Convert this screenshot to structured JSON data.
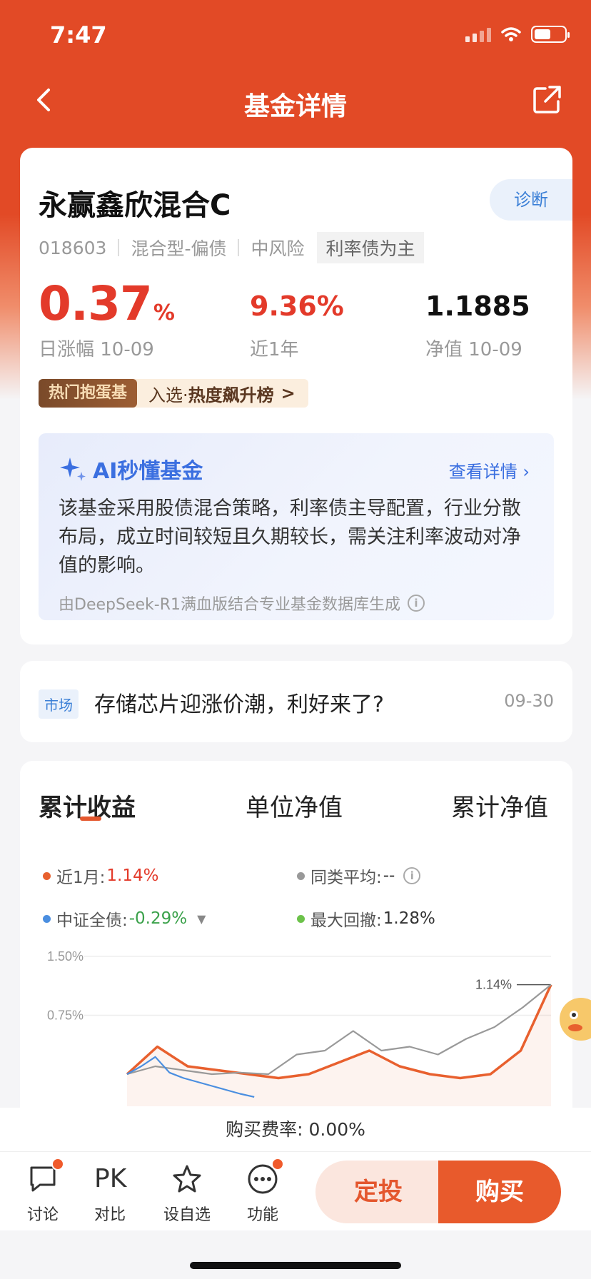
{
  "status_bar": {
    "time": "7:47"
  },
  "nav": {
    "title": "基金详情"
  },
  "fund": {
    "name": "永赢鑫欣混合C",
    "diagnose_label": "诊断",
    "code": "018603",
    "type": "混合型-偏债",
    "risk": "中风险",
    "tag": "利率债为主",
    "daily_change_value": "0.37",
    "daily_change_unit": "%",
    "daily_change_label": "日涨幅 10-09",
    "one_year_value": "9.36%",
    "one_year_label": "近1年",
    "nav_value": "1.1885",
    "nav_label": "净值 10-09",
    "hot_badge": "热门抱蛋基",
    "hot_text_prefix": "入选·",
    "hot_text_bold": "热度飙升榜"
  },
  "ai": {
    "title": "AI秒懂基金",
    "more_label": "查看详情",
    "summary": "该基金采用股债混合策略，利率债主导配置，行业分散布局，成立时间较短且久期较长，需关注利率波动对净值的影响。",
    "footer": "由DeepSeek-R1满血版结合专业基金数据库生成"
  },
  "news": {
    "tag": "市场",
    "title": "存储芯片迎涨价潮，利好来了?",
    "date": "09-30"
  },
  "chart_tabs": [
    "累计收益",
    "单位净值",
    "累计净值"
  ],
  "legend": {
    "fund_label": "近1月:",
    "fund_value": "1.14%",
    "peer_label": "同类平均:",
    "peer_value": "--",
    "index_label": "中证全债:",
    "index_value": "-0.29%",
    "drawdown_label": "最大回撤:",
    "drawdown_value": "1.28%"
  },
  "colors": {
    "fund": "#e8602e",
    "peer": "#999999",
    "index": "#4a8ee0",
    "drawdown": "#6cc24a",
    "accent": "#e24a26"
  },
  "chart_data": {
    "type": "line",
    "y_ticks": [
      "1.50%",
      "0.75%"
    ],
    "ylim": [
      0,
      1.5
    ],
    "end_label": "1.14%",
    "series": [
      {
        "name": "近1月",
        "values": [
          0.0,
          0.35,
          0.1,
          0.05,
          0.0,
          -0.05,
          0.0,
          0.15,
          0.3,
          0.1,
          0.0,
          -0.05,
          0.0,
          0.3,
          1.14
        ]
      },
      {
        "name": "同类平均",
        "values": [
          0.0,
          0.1,
          0.05,
          0.0,
          0.02,
          0.0,
          0.25,
          0.3,
          0.55,
          0.3,
          0.35,
          0.25,
          0.45,
          0.6,
          0.85,
          1.14
        ]
      },
      {
        "name": "中证全债",
        "values": [
          0.0,
          0.1,
          0.22,
          0.02,
          -0.05,
          -0.1,
          -0.15,
          -0.2,
          -0.25,
          -0.29
        ]
      }
    ]
  },
  "fee": {
    "text": "购买费率: 0.00%"
  },
  "bottom": {
    "discuss": "讨论",
    "pk_icon": "PK",
    "pk": "对比",
    "watch": "设自选",
    "func": "功能",
    "dingtou": "定投",
    "buy": "购买"
  }
}
